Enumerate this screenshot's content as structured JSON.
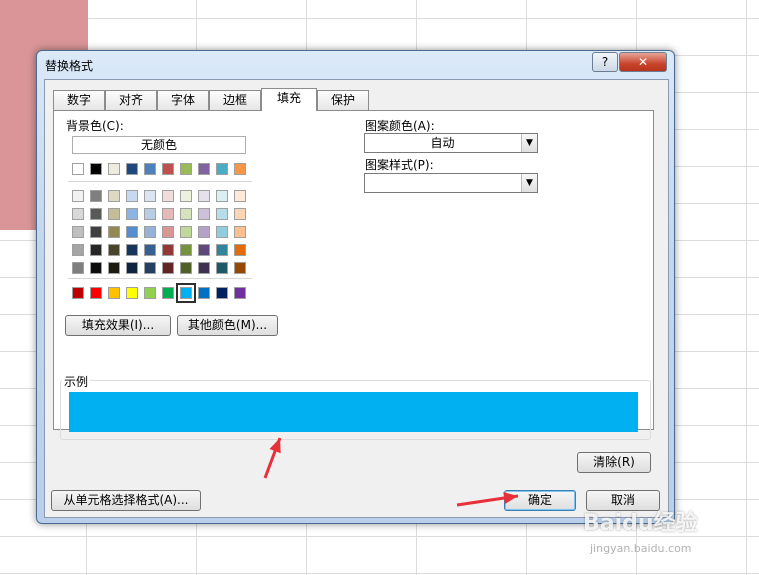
{
  "dialog": {
    "title": "替换格式",
    "help_label": "?",
    "close_label": "✕"
  },
  "tabs": [
    {
      "label": "数字"
    },
    {
      "label": "对齐"
    },
    {
      "label": "字体"
    },
    {
      "label": "边框"
    },
    {
      "label": "填充",
      "active": true
    },
    {
      "label": "保护"
    }
  ],
  "fill": {
    "background_label": "背景色(C):",
    "no_color_label": "无颜色",
    "fill_effects_label": "填充效果(I)...",
    "more_colors_label": "其他颜色(M)...",
    "pattern_color_label": "图案颜色(A):",
    "pattern_color_value": "自动",
    "pattern_style_label": "图案样式(P):",
    "pattern_style_value": "",
    "theme_top_row": [
      "#ffffff",
      "#000000",
      "#eeece1",
      "#1f497d",
      "#4f81bd",
      "#c0504d",
      "#9bbb59",
      "#8064a2",
      "#4bacc6",
      "#f79646"
    ],
    "theme_shades": [
      [
        "#f2f2f2",
        "#7f7f7f",
        "#ddd9c3",
        "#c6d9f0",
        "#dbe5f1",
        "#f2dcdb",
        "#ebf1dd",
        "#e5e0ec",
        "#dbeef3",
        "#fdeada"
      ],
      [
        "#d8d8d8",
        "#595959",
        "#c4bd97",
        "#8db3e2",
        "#b8cce4",
        "#e5b9b7",
        "#d7e3bc",
        "#ccc1d9",
        "#b7dde8",
        "#fbd5b5"
      ],
      [
        "#bfbfbf",
        "#3f3f3f",
        "#938953",
        "#548dd4",
        "#95b3d7",
        "#d99694",
        "#c3d69b",
        "#b2a2c7",
        "#92cddc",
        "#fac08f"
      ],
      [
        "#a5a5a5",
        "#262626",
        "#494429",
        "#17365d",
        "#366092",
        "#953734",
        "#76923c",
        "#5f497a",
        "#31859b",
        "#e36c09"
      ],
      [
        "#7f7f7f",
        "#0c0c0c",
        "#1d1b10",
        "#0f243e",
        "#244061",
        "#632423",
        "#4f6128",
        "#3f3151",
        "#205867",
        "#974806"
      ]
    ],
    "standard_colors": [
      "#c00000",
      "#ff0000",
      "#ffc000",
      "#ffff00",
      "#92d050",
      "#00b050",
      "#00b0f0",
      "#0070c0",
      "#002060",
      "#7030a0"
    ],
    "selected_color": "#00b0f0"
  },
  "sample": {
    "label": "示例",
    "color": "#00b0f0"
  },
  "buttons": {
    "clear_label": "清除(R)",
    "pick_from_cell_label": "从单元格选择格式(A)...",
    "ok_label": "确定",
    "cancel_label": "取消"
  },
  "watermark": {
    "text": "Baidu经验",
    "sub": "jingyan.baidu.com"
  },
  "annotation_color": "#e8303a"
}
